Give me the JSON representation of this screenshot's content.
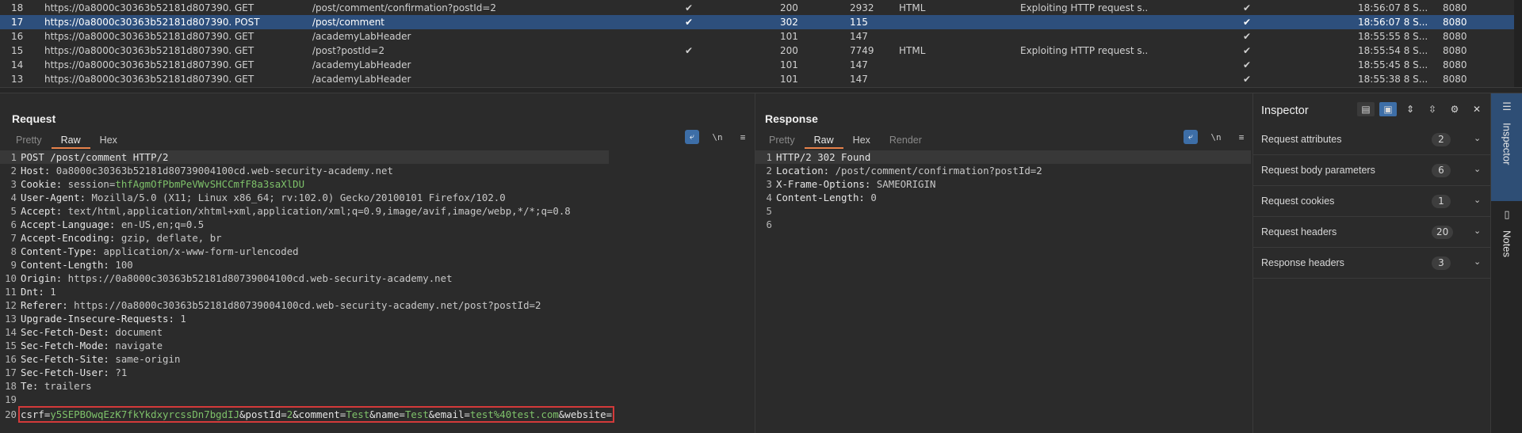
{
  "history": {
    "rows": [
      {
        "num": "18",
        "host": "https://0a8000c30363b52181d807390...",
        "method": "GET",
        "url": "/post/comment/confirmation?postId=2",
        "edited": "✔",
        "status": "200",
        "length": "2932",
        "mime": "HTML",
        "title": "Exploiting HTTP request s...",
        "tls": "✔",
        "time": "18:56:07 8 S...",
        "port": "8080"
      },
      {
        "num": "17",
        "host": "https://0a8000c30363b52181d807390...",
        "method": "POST",
        "url": "/post/comment",
        "edited": "✔",
        "status": "302",
        "length": "115",
        "mime": "",
        "title": "",
        "tls": "✔",
        "time": "18:56:07 8 S...",
        "port": "8080"
      },
      {
        "num": "16",
        "host": "https://0a8000c30363b52181d807390...",
        "method": "GET",
        "url": "/academyLabHeader",
        "edited": "",
        "status": "101",
        "length": "147",
        "mime": "",
        "title": "",
        "tls": "✔",
        "time": "18:55:55 8 S...",
        "port": "8080"
      },
      {
        "num": "15",
        "host": "https://0a8000c30363b52181d807390...",
        "method": "GET",
        "url": "/post?postId=2",
        "edited": "✔",
        "status": "200",
        "length": "7749",
        "mime": "HTML",
        "title": "Exploiting HTTP request s...",
        "tls": "✔",
        "time": "18:55:54 8 S...",
        "port": "8080"
      },
      {
        "num": "14",
        "host": "https://0a8000c30363b52181d807390...",
        "method": "GET",
        "url": "/academyLabHeader",
        "edited": "",
        "status": "101",
        "length": "147",
        "mime": "",
        "title": "",
        "tls": "✔",
        "time": "18:55:45 8 S...",
        "port": "8080"
      },
      {
        "num": "13",
        "host": "https://0a8000c30363b52181d807390...",
        "method": "GET",
        "url": "/academyLabHeader",
        "edited": "",
        "status": "101",
        "length": "147",
        "mime": "",
        "title": "",
        "tls": "✔",
        "time": "18:55:38 8 S...",
        "port": "8080"
      }
    ],
    "selected_row": "17"
  },
  "request": {
    "title": "Request",
    "tabs": [
      "Pretty",
      "Raw",
      "Hex"
    ],
    "active_tab": "Raw",
    "tool_newline": "\\n",
    "tool_menu": "≡",
    "lines": [
      {
        "n": "1",
        "text": "POST /post/comment HTTP/2"
      },
      {
        "n": "2",
        "k": "Host:",
        "v": " 0a8000c30363b52181d80739004100cd.web-security-academy.net"
      },
      {
        "n": "3",
        "k": "Cookie:",
        "v": " session=",
        "g": "thfAgmOfPbmPeVWvSHCCmfF8a3saXlDU"
      },
      {
        "n": "4",
        "k": "User-Agent:",
        "v": " Mozilla/5.0 (X11; Linux x86_64; rv:102.0) Gecko/20100101 Firefox/102.0"
      },
      {
        "n": "5",
        "k": "Accept:",
        "v": " text/html,application/xhtml+xml,application/xml;q=0.9,image/avif,image/webp,*/*;q=0.8"
      },
      {
        "n": "6",
        "k": "Accept-Language:",
        "v": " en-US,en;q=0.5"
      },
      {
        "n": "7",
        "k": "Accept-Encoding:",
        "v": " gzip, deflate, br"
      },
      {
        "n": "8",
        "k": "Content-Type:",
        "v": " application/x-www-form-urlencoded"
      },
      {
        "n": "9",
        "k": "Content-Length:",
        "v": " 100"
      },
      {
        "n": "10",
        "k": "Origin:",
        "v": " https://0a8000c30363b52181d80739004100cd.web-security-academy.net"
      },
      {
        "n": "11",
        "k": "Dnt:",
        "v": " 1"
      },
      {
        "n": "12",
        "k": "Referer:",
        "v": " https://0a8000c30363b52181d80739004100cd.web-security-academy.net/post?postId=2"
      },
      {
        "n": "13",
        "k": "Upgrade-Insecure-Requests:",
        "v": " 1"
      },
      {
        "n": "14",
        "k": "Sec-Fetch-Dest:",
        "v": " document"
      },
      {
        "n": "15",
        "k": "Sec-Fetch-Mode:",
        "v": " navigate"
      },
      {
        "n": "16",
        "k": "Sec-Fetch-Site:",
        "v": " same-origin"
      },
      {
        "n": "17",
        "k": "Sec-Fetch-User:",
        "v": " ?1"
      },
      {
        "n": "18",
        "k": "Te:",
        "v": " trailers"
      },
      {
        "n": "19",
        "text": ""
      }
    ],
    "body_line": {
      "n": "20",
      "parts": [
        {
          "t": "csrf=",
          "c": "k"
        },
        {
          "t": "y5SEPBOwqEzK7fkYkdxyrcssDn7bgdIJ",
          "c": "g"
        },
        {
          "t": "&postId=",
          "c": "k"
        },
        {
          "t": "2",
          "c": "g"
        },
        {
          "t": "&comment=",
          "c": "k"
        },
        {
          "t": "Test",
          "c": "g"
        },
        {
          "t": "&name=",
          "c": "k"
        },
        {
          "t": "Test",
          "c": "g"
        },
        {
          "t": "&email=",
          "c": "k"
        },
        {
          "t": "test%40test.com",
          "c": "g"
        },
        {
          "t": "&website=",
          "c": "k"
        }
      ]
    }
  },
  "response": {
    "title": "Response",
    "tabs": [
      "Pretty",
      "Raw",
      "Hex",
      "Render"
    ],
    "active_tab": "Raw",
    "tool_newline": "\\n",
    "tool_menu": "≡",
    "lines": [
      {
        "n": "1",
        "text": "HTTP/2 302 Found"
      },
      {
        "n": "2",
        "k": "Location:",
        "v": " /post/comment/confirmation?postId=2"
      },
      {
        "n": "3",
        "k": "X-Frame-Options:",
        "v": " SAMEORIGIN"
      },
      {
        "n": "4",
        "k": "Content-Length:",
        "v": " 0"
      },
      {
        "n": "5",
        "text": ""
      },
      {
        "n": "6",
        "text": ""
      }
    ]
  },
  "inspector": {
    "title": "Inspector",
    "sections": [
      {
        "label": "Request attributes",
        "count": "2"
      },
      {
        "label": "Request body parameters",
        "count": "6"
      },
      {
        "label": "Request cookies",
        "count": "1"
      },
      {
        "label": "Request headers",
        "count": "20"
      },
      {
        "label": "Response headers",
        "count": "3"
      }
    ]
  },
  "rail": {
    "tabs": [
      {
        "label": "Inspector",
        "icon": "sliders-icon"
      },
      {
        "label": "Notes",
        "icon": "notes-icon"
      }
    ]
  },
  "colors": {
    "accent": "#e8824a",
    "selection": "#2d4f7c",
    "highlight_box": "#d33a3a",
    "param_value": "#7ec26a"
  }
}
